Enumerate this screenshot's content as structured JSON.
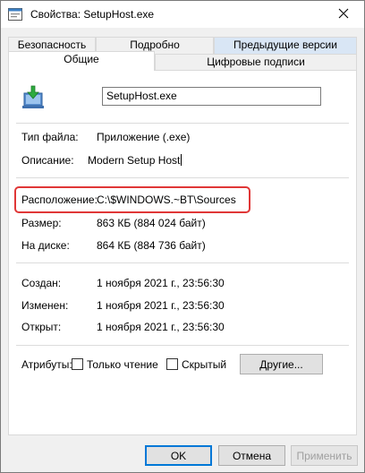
{
  "window": {
    "title": "Свойства: SetupHost.exe"
  },
  "tabs": {
    "row1": [
      {
        "label": "Безопасность"
      },
      {
        "label": "Подробно"
      },
      {
        "label": "Предыдущие версии"
      }
    ],
    "row2": [
      {
        "label": "Общие"
      },
      {
        "label": "Цифровые подписи"
      }
    ]
  },
  "general": {
    "file_name": "SetupHost.exe",
    "file_type_label": "Тип файла:",
    "file_type_value": "Приложение (.exe)",
    "description_label": "Описание:",
    "description_value": "Modern Setup Host",
    "location_label": "Расположение:",
    "location_value": "C:\\$WINDOWS.~BT\\Sources",
    "size_label": "Размер:",
    "size_value": "863 КБ (884 024 байт)",
    "disk_size_label": "На диске:",
    "disk_size_value": "864 КБ (884 736 байт)",
    "created_label": "Создан:",
    "created_value": "1 ноября 2021 г., 23:56:30",
    "modified_label": "Изменен:",
    "modified_value": "1 ноября 2021 г., 23:56:30",
    "opened_label": "Открыт:",
    "opened_value": "1 ноября 2021 г., 23:56:30",
    "attributes_label": "Атрибуты:",
    "readonly_label": "Только чтение",
    "hidden_label": "Скрытый",
    "other_button": "Другие..."
  },
  "footer": {
    "ok": "OK",
    "cancel": "Отмена",
    "apply": "Применить"
  },
  "colors": {
    "highlight": "#e03737",
    "active_tab_accent": "#d9e6f5",
    "primary_border": "#0078d7"
  },
  "icons": {
    "title": "properties-icon",
    "close": "close-icon",
    "file": "setup-app-icon"
  }
}
